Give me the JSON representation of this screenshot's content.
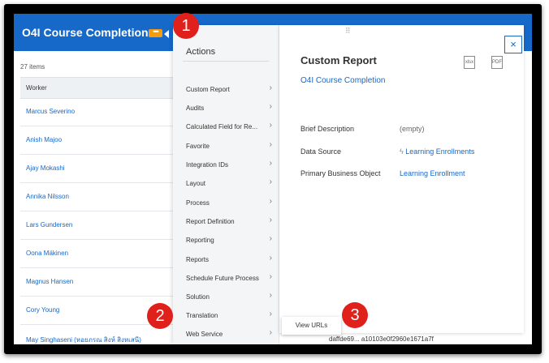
{
  "header": {
    "title": "O4I Course Completion",
    "badge": "•••"
  },
  "grid": {
    "items_count": "27 items",
    "column_header": "Worker",
    "rows": [
      "Marcus Severino",
      "Anish Majoo",
      "Ajay Mokashi",
      "Annika Nilsson",
      "Lars Gundersen",
      "Oona Mäkinen",
      "Magnus Hansen",
      "Cory Young",
      "May Singhaseni (หอยภรณ สิงห์ สิงหเสนี)"
    ]
  },
  "actions": {
    "title": "Actions",
    "items": [
      "Custom Report",
      "Audits",
      "Calculated Field for Re...",
      "Favorite",
      "Integration IDs",
      "Layout",
      "Process",
      "Report Definition",
      "Reporting",
      "Reports",
      "Schedule Future Process",
      "Solution",
      "Translation",
      "Web Service"
    ]
  },
  "detail": {
    "drag_handle": "⠿",
    "close": "×",
    "title": "Custom Report",
    "report_link": "O4I Course Completion",
    "excel_icon": "xlsx",
    "pdf_icon": "PDF",
    "fields": {
      "brief_description_label": "Brief Description",
      "brief_description_value": "(empty)",
      "data_source_label": "Data Source",
      "data_source_value": "Learning Enrollments",
      "primary_bo_label": "Primary Business Object",
      "primary_bo_value": "Learning Enrollment"
    }
  },
  "submenu": {
    "view_urls": "View URLs"
  },
  "hash": "daffde69... a10103e0f2960e1671a7f",
  "markers": [
    "1",
    "2",
    "3"
  ]
}
